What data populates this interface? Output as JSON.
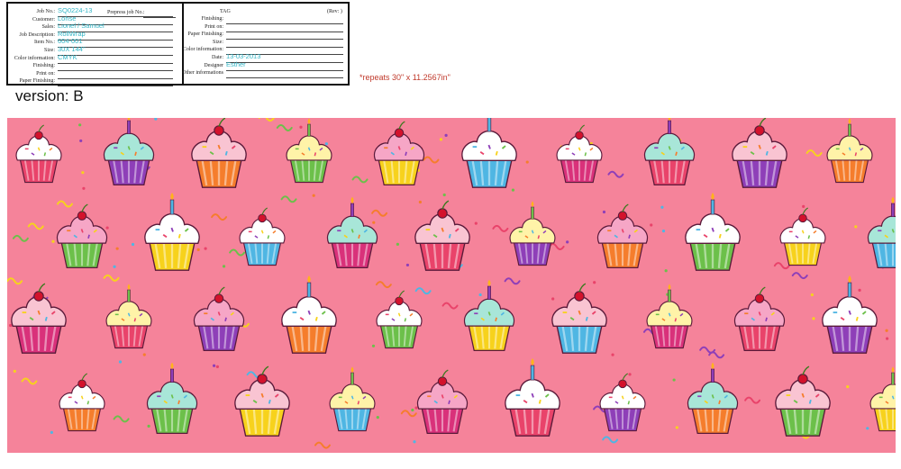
{
  "job_form": {
    "left": [
      {
        "label": "Job No.:",
        "value": "SQ0224-13"
      },
      {
        "label": "Customer:",
        "value": "Lohse"
      },
      {
        "label": "Sales:",
        "value": "Lionel / Samuel"
      },
      {
        "label": "Job Description:",
        "value": "RollWrap"
      },
      {
        "label": "Item No.:",
        "value": "604-001"
      },
      {
        "label": "Size:",
        "value": "30X 144\""
      },
      {
        "label": "Color information:",
        "value": "CMYK"
      },
      {
        "label": "Finishing:",
        "value": ""
      },
      {
        "label": "Print on:",
        "value": ""
      },
      {
        "label": "Paper Finishing:",
        "value": ""
      }
    ],
    "prepress_label": "Prepress job No.:",
    "tag_label": "TAG",
    "rev_label": "(Rev:   )",
    "right": [
      {
        "label": "Finishing:",
        "value": ""
      },
      {
        "label": "Print on:",
        "value": ""
      },
      {
        "label": "Paper Finishing:",
        "value": ""
      },
      {
        "label": "Size:",
        "value": ""
      },
      {
        "label": "Color information:",
        "value": ""
      },
      {
        "label": "Date:",
        "value": "13-03-2013"
      },
      {
        "label": "Designer",
        "value": "Esther"
      },
      {
        "label": "Other informations",
        "value": ""
      }
    ]
  },
  "repeat_note": "*repeats 30\" x 11.2567in\"",
  "version_label": "version: B",
  "artwork": {
    "background_color": "#f5839a",
    "motif": "cupcake-pattern",
    "palette": [
      "#e9436a",
      "#8e3fb8",
      "#f7d21c",
      "#6cc04a",
      "#f57d2c",
      "#4fb6e3",
      "#ffffff",
      "#7a3f2a"
    ]
  }
}
